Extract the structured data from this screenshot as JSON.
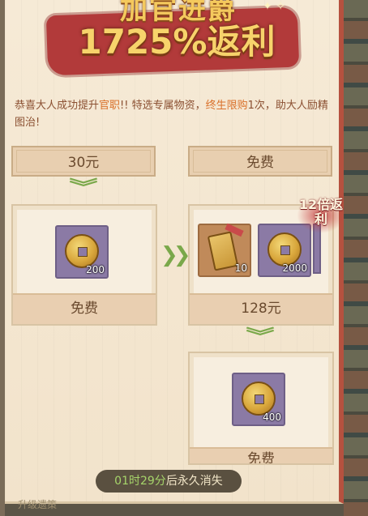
{
  "banner": {
    "top_text": "加官进爵",
    "main_text": "1725%返利",
    "sparkle": "✦ ✧"
  },
  "intro": {
    "part1": "恭喜大人成功提升",
    "highlight1": "官职",
    "part2": "!! 特选专属物资，",
    "highlight2": "终生限购",
    "part3": "1次，助大人励精图治!"
  },
  "tiers": {
    "left": {
      "price_top": "30元",
      "item": {
        "icon": "copper-coin",
        "qty": "200"
      },
      "price_bottom": "免费"
    },
    "right": {
      "price_top": "免费",
      "items": [
        {
          "icon": "gold-token",
          "qty": "10"
        },
        {
          "icon": "copper-coin",
          "qty": "2000"
        }
      ],
      "price_bottom": "128元",
      "badge": "12倍返利"
    },
    "bottom": {
      "item": {
        "icon": "copper-coin",
        "qty": "400"
      },
      "price_bottom": "免费"
    }
  },
  "timer": {
    "value": "01时29分",
    "suffix": "后永久消失"
  },
  "bottom_text": "升级遗策",
  "colors": {
    "accent_red": "#b23a3a",
    "gold_text": "#f7d36b",
    "arrow_green": "#7aa84a",
    "slot_purple": "#8b7aa5",
    "slot_orange": "#c08a5a"
  }
}
